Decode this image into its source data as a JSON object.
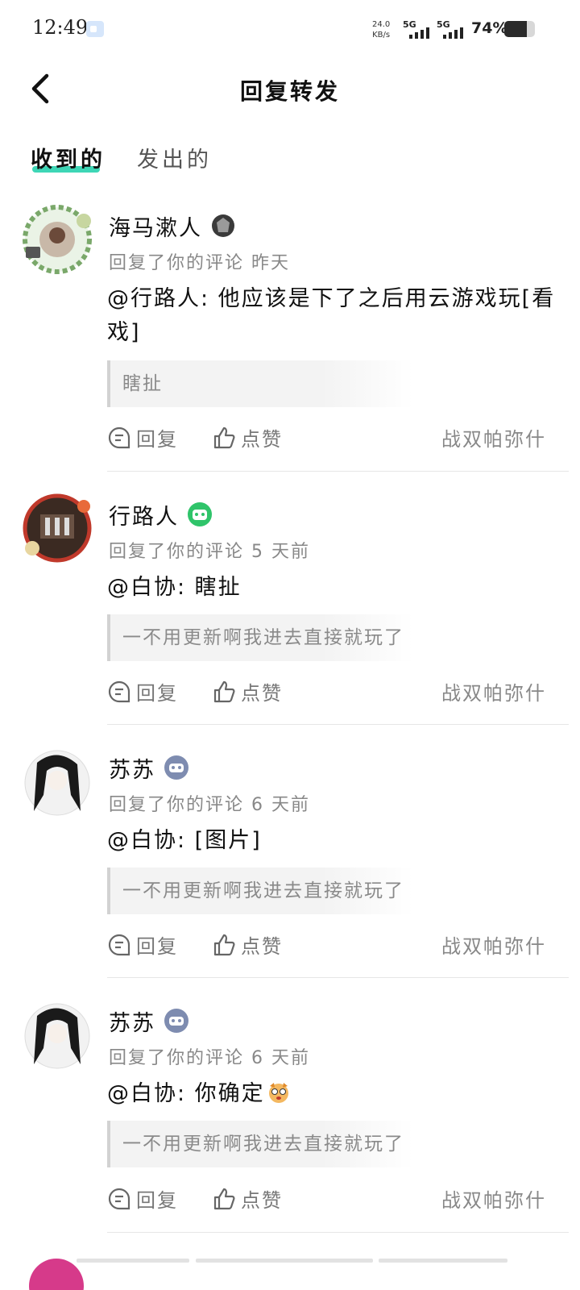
{
  "status_bar": {
    "time": "12:49",
    "speed_value": "24.0",
    "speed_unit": "KB/s",
    "sim1_label": "5G",
    "sim2_label": "5G",
    "battery_text": "74%",
    "battery_level": 0.74
  },
  "header": {
    "back_icon": "chevron-left-icon",
    "title": "回复转发"
  },
  "tabs": [
    {
      "label": "收到的",
      "active": true
    },
    {
      "label": "发出的",
      "active": false
    }
  ],
  "actions": {
    "reply_label": "回复",
    "like_label": "点赞"
  },
  "notifications": [
    {
      "username": "海马漱人",
      "meta": "回复了你的评论 昨天",
      "content": "@行路人: 他应该是下了之后用云游戏玩[看戏]",
      "quote": "瞎扯",
      "source": "战双帕弥什"
    },
    {
      "username": "行路人",
      "meta": "回复了你的评论 5 天前",
      "content": "@白协: 瞎扯",
      "quote": "一不用更新啊我进去直接就玩了",
      "source": "战双帕弥什"
    },
    {
      "username": "苏苏",
      "meta": "回复了你的评论 6 天前",
      "content": "@白协: [图片]",
      "quote": "一不用更新啊我进去直接就玩了",
      "source": "战双帕弥什"
    },
    {
      "username": "苏苏",
      "meta": "回复了你的评论 6 天前",
      "content": "@白协: 你确定",
      "quote": "一不用更新啊我进去直接就玩了",
      "source": "战双帕弥什"
    }
  ],
  "colors": {
    "accent": "#3ed6b6",
    "badge_green": "#2fc46a",
    "badge_gamepad": "#7e8cb0"
  }
}
